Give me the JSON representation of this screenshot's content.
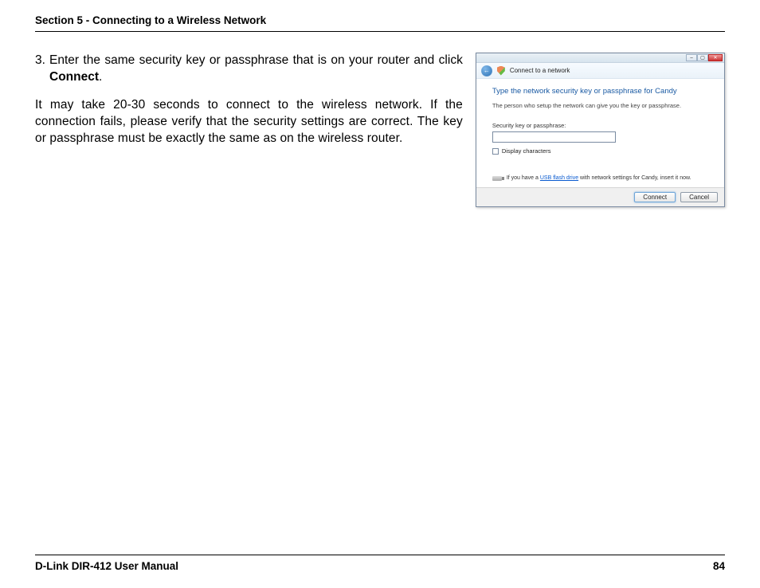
{
  "header": {
    "section_title": "Section 5 - Connecting to a Wireless Network"
  },
  "body": {
    "step_number": "3.",
    "step_text_before_bold": "Enter the same security key or passphrase that is on your router and click ",
    "step_text_bold": "Connect",
    "step_text_period": ".",
    "paragraph2": "It may take 20-30 seconds to connect to the wireless network. If the connection fails, please verify that the security settings are correct. The key or passphrase must be exactly the same as on the wireless router."
  },
  "dialog": {
    "nav_title": "Connect to a network",
    "heading": "Type the network security key or passphrase for Candy",
    "subtext": "The person who setup the network can give you the key or passphrase.",
    "field_label": "Security key or passphrase:",
    "display_characters": "Display characters",
    "usb_pre": "If you have a ",
    "usb_link": "USB flash drive",
    "usb_post": " with network settings for Candy, insert it now.",
    "buttons": {
      "connect": "Connect",
      "cancel": "Cancel"
    },
    "window_controls": {
      "minimize": "–",
      "maximize": "▢",
      "close": "✕"
    },
    "back_arrow": "←"
  },
  "footer": {
    "manual_title": "D-Link DIR-412 User Manual",
    "page_number": "84"
  }
}
